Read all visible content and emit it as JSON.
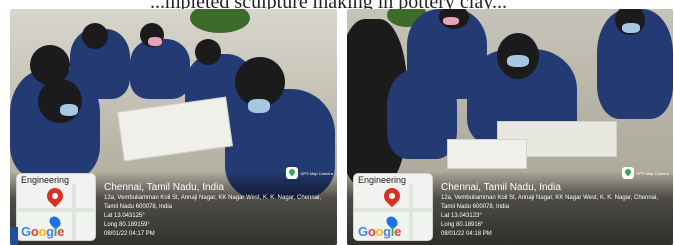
{
  "caption": "...mpleted sculpture making in pottery clay...",
  "photos": [
    {
      "id": "left",
      "map_label": "Engineering",
      "google_text": "Google",
      "app_badge": "GPS Map Camera",
      "location": {
        "city": "Chennai, Tamil Nadu, India",
        "address_1": "12a, Vembuliamman Koil St, Annaji Nagar, KK Nagar West, K. K. Nagar, Chennai,",
        "address_2": "Tamil Nadu 600078, India",
        "lat": "Lat 13.043125°",
        "long": "Long 80.189159°",
        "datetime": "08/01/22 04:17 PM"
      }
    },
    {
      "id": "right",
      "map_label": "Engineering",
      "google_text": "Google",
      "app_badge": "GPS Map Camera",
      "location": {
        "city": "Chennai, Tamil Nadu, India",
        "address_1": "12a, Vembuliamman Koil St, Annaji Nagar, KK Nagar West, K. K. Nagar, Chennai,",
        "address_2": "Tamil Nadu 600078, India",
        "lat": "Lat 13.043123°",
        "long": "Long 80.18916°",
        "datetime": "08/01/22 04:18 PM"
      }
    }
  ],
  "colors": {
    "uniform": "#243a73",
    "pin": "#d93025",
    "overlay_text": "#ffffff"
  }
}
